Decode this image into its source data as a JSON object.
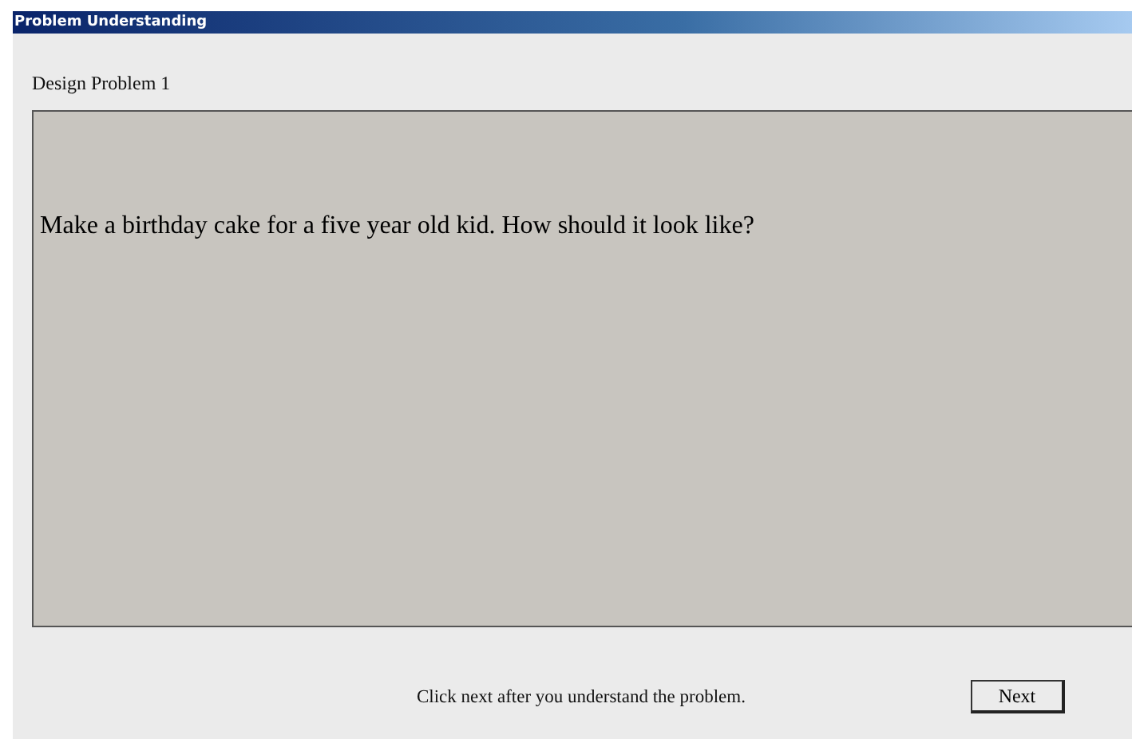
{
  "window": {
    "title": "Problem Understanding"
  },
  "heading": "Design Problem 1",
  "problem": {
    "text": "Make a birthday cake for a five year old kid. How should it look like?"
  },
  "footer": {
    "hint": "Click next after you understand the problem.",
    "buttons": [
      "Next"
    ]
  }
}
